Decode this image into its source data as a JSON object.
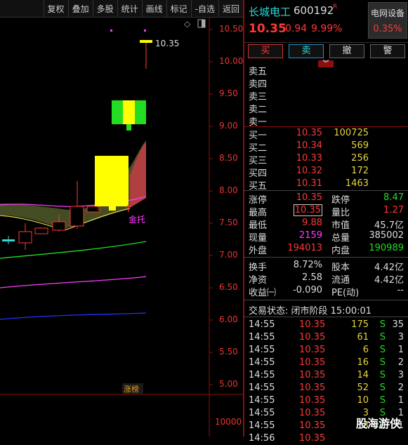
{
  "toolbar": {
    "items": [
      "复权",
      "叠加",
      "多股",
      "统计",
      "画线",
      "标记",
      "-自选",
      "返回"
    ]
  },
  "chart": {
    "price_ticks": [
      "10.50",
      "10.00",
      "9.50",
      "9.00",
      "8.50",
      "8.00",
      "7.50",
      "7.00",
      "6.50",
      "6.00",
      "5.50",
      "5.00"
    ],
    "volume_tick": "10000",
    "high_label": "10.35",
    "annotation": "金托",
    "limit_up_tag": "涨榜",
    "colors": {
      "up": "#ff3838",
      "down": "#2fd7d7",
      "limit_fill": "#ffff00",
      "ma_green": "#22dd22",
      "ma_mag": "#ff3cff",
      "ma_blue": "#2233ff"
    }
  },
  "quote": {
    "name": "长城电工",
    "code": "600192",
    "tag": "R",
    "price": "10.35",
    "change": "0.94",
    "change_pct": "9.99%",
    "sector_name": "电网设备",
    "sector_pct": "0.35%"
  },
  "buttons": {
    "buy": "买",
    "sell": "卖",
    "cancel": "撤",
    "alert": "警"
  },
  "asks": [
    "卖五",
    "卖四",
    "卖三",
    "卖二",
    "卖一"
  ],
  "bids": [
    {
      "label": "买一",
      "price": "10.35",
      "vol": "100725"
    },
    {
      "label": "买二",
      "price": "10.34",
      "vol": "569"
    },
    {
      "label": "买三",
      "price": "10.33",
      "vol": "256"
    },
    {
      "label": "买四",
      "price": "10.32",
      "vol": "172"
    },
    {
      "label": "买五",
      "price": "10.31",
      "vol": "1463"
    }
  ],
  "stats1": [
    {
      "l1": "涨停",
      "v1": "10.35",
      "l2": "跌停",
      "v2": "8.47"
    },
    {
      "l1": "最高",
      "v1": "10.35",
      "l2": "量比",
      "v2": "1.27"
    },
    {
      "l1": "最低",
      "v1": "9.88",
      "l2": "市值",
      "v2": "45.7亿"
    },
    {
      "l1": "现量",
      "v1": "2159",
      "l2": "总量",
      "v2": "385002"
    },
    {
      "l1": "外盘",
      "v1": "194013",
      "l2": "内盘",
      "v2": "190989"
    }
  ],
  "stats2": [
    {
      "l1": "换手",
      "v1": "8.72%",
      "l2": "股本",
      "v2": "4.42亿"
    },
    {
      "l1": "净资",
      "v1": "2.58",
      "l2": "流通",
      "v2": "4.42亿"
    },
    {
      "l1": "收益㈠",
      "v1": "-0.090",
      "l2": "PE(动)",
      "v2": "--"
    }
  ],
  "trade_status": "交易状态: 闭市阶段 15:00:01",
  "trades": [
    {
      "t": "14:55",
      "p": "10.35",
      "v": "175",
      "s": "S",
      "n": "35"
    },
    {
      "t": "14:55",
      "p": "10.35",
      "v": "61",
      "s": "S",
      "n": "3"
    },
    {
      "t": "14:55",
      "p": "10.35",
      "v": "6",
      "s": "S",
      "n": "1"
    },
    {
      "t": "14:55",
      "p": "10.35",
      "v": "16",
      "s": "S",
      "n": "2"
    },
    {
      "t": "14:55",
      "p": "10.35",
      "v": "14",
      "s": "S",
      "n": "3"
    },
    {
      "t": "14:55",
      "p": "10.35",
      "v": "52",
      "s": "S",
      "n": "2"
    },
    {
      "t": "14:55",
      "p": "10.35",
      "v": "10",
      "s": "S",
      "n": "1"
    },
    {
      "t": "14:55",
      "p": "10.35",
      "v": "3",
      "s": "S",
      "n": "1"
    },
    {
      "t": "14:55",
      "p": "10.35",
      "v": "3",
      "s": "S",
      "n": "1"
    },
    {
      "t": "14:56",
      "p": "10.35",
      "v": "",
      "s": "",
      "n": ""
    }
  ],
  "watermark": "股海游侠"
}
